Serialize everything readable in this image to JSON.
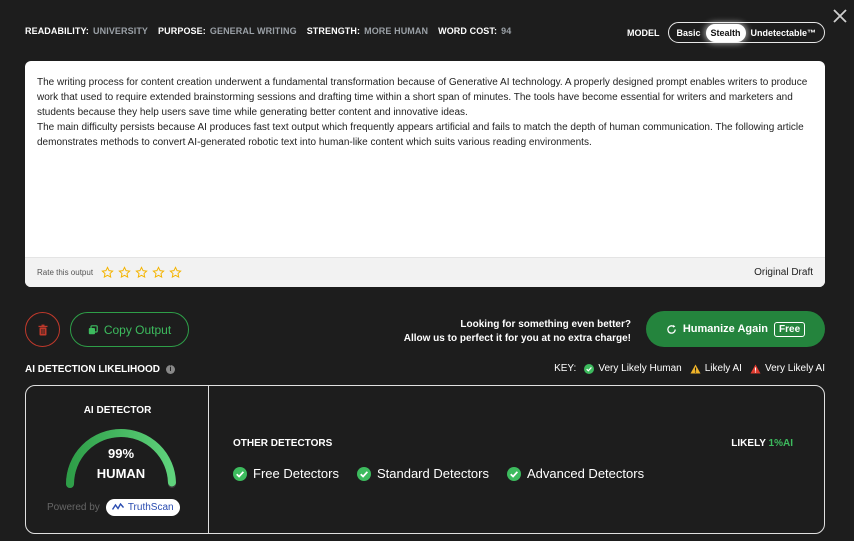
{
  "meta": {
    "readability_key": "READABILITY:",
    "readability_val": "UNIVERSITY",
    "purpose_key": "PURPOSE:",
    "purpose_val": "GENERAL WRITING",
    "strength_key": "STRENGTH:",
    "strength_val": "MORE HUMAN",
    "wordcost_key": "WORD COST:",
    "wordcost_val": "94"
  },
  "model": {
    "label": "MODEL",
    "options": [
      "Basic",
      "Stealth",
      "Undetectable™"
    ],
    "selected": "Stealth"
  },
  "output": {
    "paragraph1": "The writing process for content creation underwent a fundamental transformation because of Generative AI technology. A properly designed prompt enables writers to produce work that used to require extended brainstorming sessions and drafting time within a short span of minutes. The tools have become essential for writers and marketers and students because they help users save time while generating better content and innovative ideas.",
    "paragraph2": "The main difficulty persists because AI produces fast text output which frequently appears artificial and fails to match the depth of human communication. The following article demonstrates methods to convert AI-generated robotic text into human-like content which suits various reading environments.",
    "rate_label": "Rate this output",
    "draft_label": "Original Draft",
    "star_icon": "star-icon",
    "star_color": "#f5b400"
  },
  "actions": {
    "copy_label": "Copy Output",
    "promo_line1": "Looking for something even better?",
    "promo_line2": "Allow us to perfect it for you at no extra charge!",
    "humanize_label": "Humanize Again",
    "humanize_badge": "Free",
    "accent": "#24843d",
    "danger": "#c0392b"
  },
  "detection": {
    "heading": "AI DETECTION LIKELIHOOD",
    "key_label": "KEY:",
    "key_human": "Very Likely Human",
    "key_likely_ai": "Likely AI",
    "key_very_ai": "Very Likely AI",
    "detector_title": "AI DETECTOR",
    "gauge_value": "99%",
    "gauge_fraction": 0.99,
    "gauge_label": "HUMAN",
    "powered_by": "Powered by",
    "powered_brand": "TruthScan",
    "other_title": "OTHER DETECTORS",
    "likely_prefix": "LIKELY",
    "likely_value": "1%AI",
    "detectors": [
      "Free Detectors",
      "Standard Detectors",
      "Advanced Detectors"
    ],
    "human_color": "#3dbb5e",
    "warn_color": "#f0b429",
    "ai_color": "#e03b2f"
  }
}
